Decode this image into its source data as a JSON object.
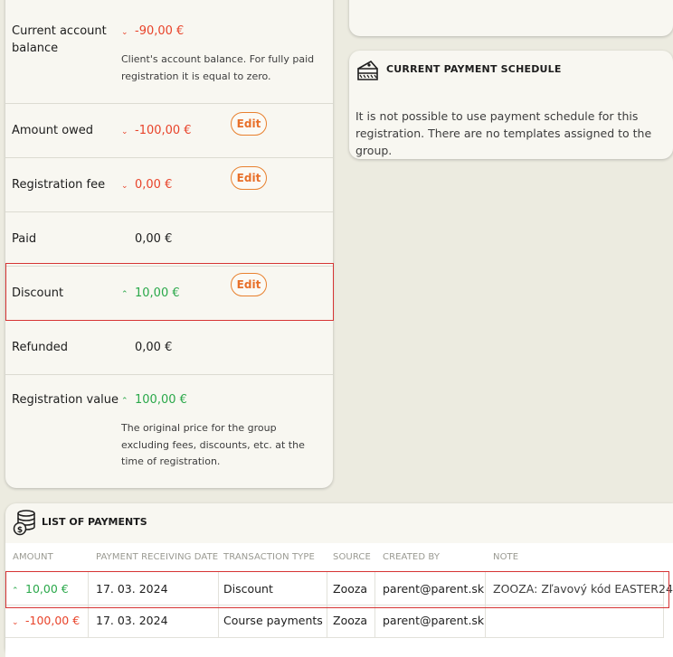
{
  "balance": {
    "current_account_balance": {
      "label": "Current account balance",
      "value": "-90,00 €",
      "help": "Client's account balance. For fully paid registration it is equal to zero."
    },
    "amount_owed": {
      "label": "Amount owed",
      "value": "-100,00 €",
      "action": "Edit"
    },
    "registration_fee": {
      "label": "Registration fee",
      "value": "0,00 €",
      "action": "Edit"
    },
    "paid": {
      "label": "Paid",
      "value": "0,00 €"
    },
    "discount": {
      "label": "Discount",
      "value": "10,00 €",
      "action": "Edit"
    },
    "refunded": {
      "label": "Refunded",
      "value": "0,00 €"
    },
    "registration_value": {
      "label": "Registration value",
      "value": "100,00 €",
      "help": "The original price for the group excluding fees, discounts, etc. at the time of registration."
    }
  },
  "schedule": {
    "title": "CURRENT PAYMENT SCHEDULE",
    "text": "It is not possible to use payment schedule for this registration. There are no templates assigned to the group."
  },
  "payments": {
    "title": "LIST OF PAYMENTS",
    "columns": [
      "AMOUNT",
      "PAYMENT RECEIVING DATE",
      "TRANSACTION TYPE",
      "SOURCE",
      "CREATED BY",
      "NOTE"
    ],
    "rows": [
      {
        "amount": "10,00 €",
        "direction": "up",
        "date": "17. 03. 2024",
        "type": "Discount",
        "source": "Zooza",
        "created_by": "parent@parent.sk",
        "note": "ZOOZA: Zľavový kód EASTER24"
      },
      {
        "amount": "-100,00 €",
        "direction": "down",
        "date": "17. 03. 2024",
        "type": "Course payments",
        "source": "Zooza",
        "created_by": "parent@parent.sk",
        "note": ""
      }
    ]
  },
  "colors": {
    "negative": "#e8432a",
    "positive": "#2aa84a",
    "accent": "#e8702a",
    "highlight": "#d63434"
  },
  "icons": {
    "schedule": "cake-slice-icon",
    "payments": "coin-stack-icon",
    "down": "chevron-down-icon",
    "up": "chevron-up-icon"
  }
}
